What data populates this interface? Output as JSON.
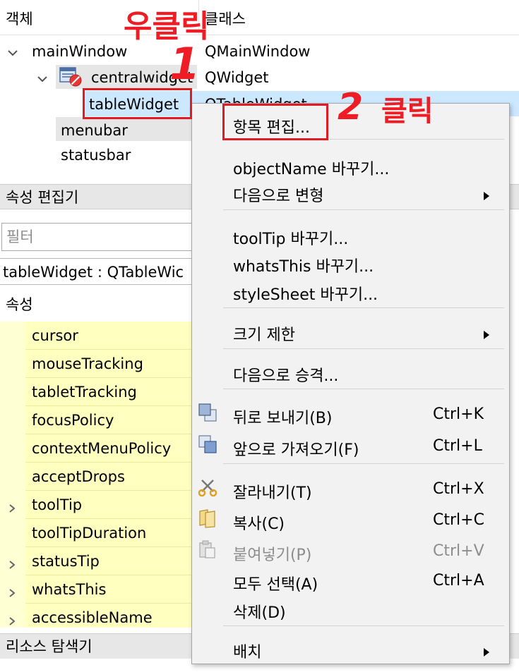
{
  "object_inspector": {
    "col_object": "객체",
    "col_class": "클래스",
    "rows": [
      {
        "name": "mainWindow",
        "class": "QMainWindow"
      },
      {
        "name": "centralwidget",
        "class": "QWidget"
      },
      {
        "name": "tableWidget",
        "class": "QTableWidget"
      },
      {
        "name": "menubar",
        "class": ""
      },
      {
        "name": "statusbar",
        "class": ""
      }
    ]
  },
  "property_editor": {
    "title": "속성 편집기",
    "filter_placeholder": "필터",
    "object_class": "tableWidget : QTableWic",
    "col_property": "속성",
    "properties": [
      {
        "name": "cursor",
        "expandable": false
      },
      {
        "name": "mouseTracking",
        "expandable": false
      },
      {
        "name": "tabletTracking",
        "expandable": false
      },
      {
        "name": "focusPolicy",
        "expandable": false
      },
      {
        "name": "contextMenuPolicy",
        "expandable": false
      },
      {
        "name": "acceptDrops",
        "expandable": false
      },
      {
        "name": "toolTip",
        "expandable": true
      },
      {
        "name": "toolTipDuration",
        "expandable": false
      },
      {
        "name": "statusTip",
        "expandable": true
      },
      {
        "name": "whatsThis",
        "expandable": true
      },
      {
        "name": "accessibleName",
        "expandable": true
      }
    ]
  },
  "resource_browser": {
    "title": "리소스 탐색기"
  },
  "context_menu": {
    "edit_items": "항목 편집...",
    "change_object_name": "objectName 바꾸기...",
    "morph_into": "다음으로 변형",
    "change_tooltip": "toolTip 바꾸기...",
    "change_whatsthis": "whatsThis 바꾸기...",
    "change_stylesheet": "styleSheet 바꾸기...",
    "size_constraints": "크기 제한",
    "promote_to": "다음으로 승격...",
    "send_to_back": {
      "label": "뒤로 보내기(B)",
      "shortcut": "Ctrl+K"
    },
    "bring_to_front": {
      "label": "앞으로 가져오기(F)",
      "shortcut": "Ctrl+L"
    },
    "cut": {
      "label": "잘라내기(T)",
      "shortcut": "Ctrl+X"
    },
    "copy": {
      "label": "복사(C)",
      "shortcut": "Ctrl+C"
    },
    "paste": {
      "label": "붙여넣기(P)",
      "shortcut": "Ctrl+V"
    },
    "select_all": {
      "label": "모두 선택(A)",
      "shortcut": "Ctrl+A"
    },
    "delete": "삭제(D)",
    "layout": "배치"
  },
  "annotations": {
    "step1_text": "우클릭",
    "step1_number": "1",
    "step2_number": "2",
    "step2_text": "클릭"
  },
  "colors": {
    "annotation_red": "#ee1c24",
    "property_row_bg": "#ffffbf",
    "selection_bg": "#cce8ff",
    "menu_bg": "#f2f2f2"
  }
}
